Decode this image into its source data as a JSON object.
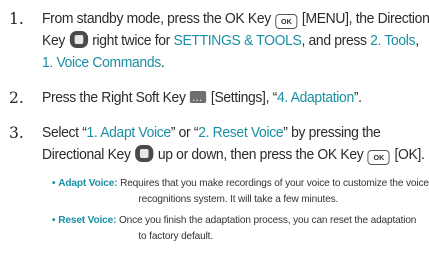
{
  "steps": [
    {
      "num": "1.",
      "l1_a": "From standby mode, press the OK Key",
      "l1_key": "OK",
      "l1_b": "[MENU], the Directional",
      "l2_a": "Key",
      "l2_b": "right twice for",
      "l2_c": "SETTINGS & TOOLS",
      "l2_d": ", and press",
      "l2_e": "2. Tools",
      "l2_f": ",",
      "l3_a": "1. Voice Commands",
      "l3_b": "."
    },
    {
      "num": "2.",
      "a": "Press the Right Soft Key",
      "b": "[Settings], “",
      "c": "4. Adaptation",
      "d": "”."
    },
    {
      "num": "3.",
      "l1_a": "Select “",
      "l1_b": "1. Adapt Voice",
      "l1_c": "” or “",
      "l1_d": "2. Reset Voice",
      "l1_e": "” by pressing the",
      "l2_a": "Directional Key",
      "l2_b": "up or down, then press the OK Key",
      "l2_key": "OK",
      "l2_c": "[OK]."
    }
  ],
  "bullets": [
    {
      "term": "Adapt Voice:",
      "l1": "Requires that you make recordings of your voice to customize the voice",
      "l2": "recognitions system. It will take a few minutes."
    },
    {
      "term": "Reset Voice:",
      "l1": "Once you finish the adaptation process, you can reset the adaptation",
      "l2": "to factory default."
    }
  ],
  "colors": {
    "accent": "#1a8fa3",
    "text": "#2b2b2b"
  },
  "icons": [
    "ok-key-icon",
    "directional-key-icon",
    "right-soft-key-icon"
  ]
}
